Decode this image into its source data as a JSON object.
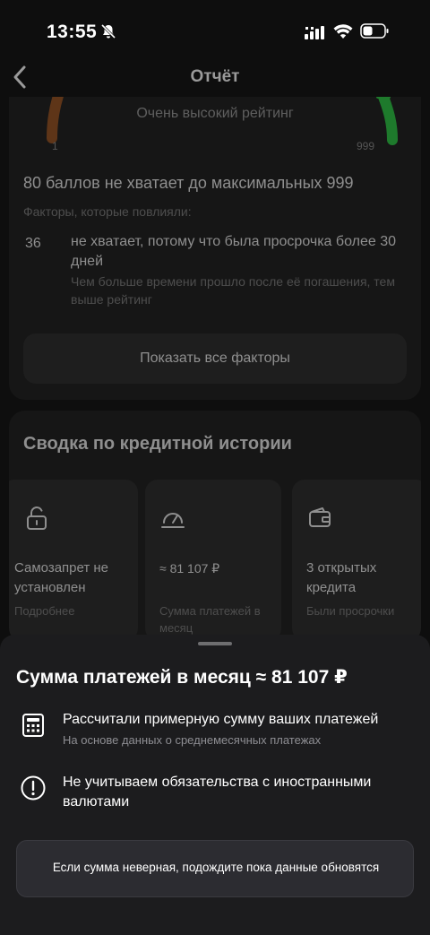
{
  "status_bar": {
    "time": "13:55"
  },
  "header": {
    "title": "Отчёт"
  },
  "score_card": {
    "rating_label": "Очень высокий рейтинг",
    "scale_min": "1",
    "scale_max": "999",
    "headline": "80 баллов не хватает до максимальных 999",
    "factors_label": "Факторы, которые повлияли:",
    "factor": {
      "points": "36",
      "title": "не хватает, потому что была просрочка более 30 дней",
      "description": "Чем больше времени прошло после её погашения, тем выше рейтинг"
    },
    "show_all_label": "Показать все факторы"
  },
  "summary": {
    "title": "Сводка по кредитной истории",
    "tiles": [
      {
        "title": "Самозапрет не установлен",
        "subtitle": "Подробнее",
        "icon": "lock-icon"
      },
      {
        "title": "≈ 81 107 ₽",
        "subtitle": "Сумма платежей в месяц",
        "icon": "gauge-icon"
      },
      {
        "title": "3 открытых кредита",
        "subtitle": "Были просрочки",
        "icon": "wallet-icon"
      }
    ]
  },
  "sheet": {
    "title": "Сумма платежей в месяц ≈ 81 107 ₽",
    "rows": [
      {
        "title": "Рассчитали примерную сумму ваших платежей",
        "subtitle": "На основе данных о среднемесячных платежах",
        "icon": "calculator-icon"
      },
      {
        "title": "Не учитываем обязательства с иностранными валютами",
        "icon": "info-icon"
      }
    ],
    "notice": "Если сумма неверная, подождите пока данные обновятся"
  },
  "colors": {
    "gauge_low": "#6b3a1f",
    "gauge_high": "#1e7a2c",
    "sheet_bg": "#1c1c1e",
    "notice_bg": "#2c2c31"
  }
}
